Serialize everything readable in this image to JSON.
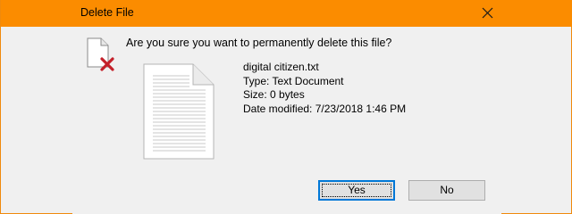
{
  "window": {
    "title": "Delete File",
    "close_icon": "close-icon",
    "titlebar_color": "#fb8c00"
  },
  "dialog": {
    "question": "Are you sure you want to permanently delete this file?",
    "icons": {
      "warning": "delete-file-icon",
      "preview": "text-document-icon"
    },
    "file": {
      "name": "digital citizen.txt",
      "type": "Type: Text Document",
      "size": "Size: 0 bytes",
      "date_modified": "Date modified: 7/23/2018 1:46 PM"
    }
  },
  "buttons": {
    "yes": {
      "label": "Yes",
      "accent": "#0078d7"
    },
    "no": {
      "label": "No"
    }
  }
}
